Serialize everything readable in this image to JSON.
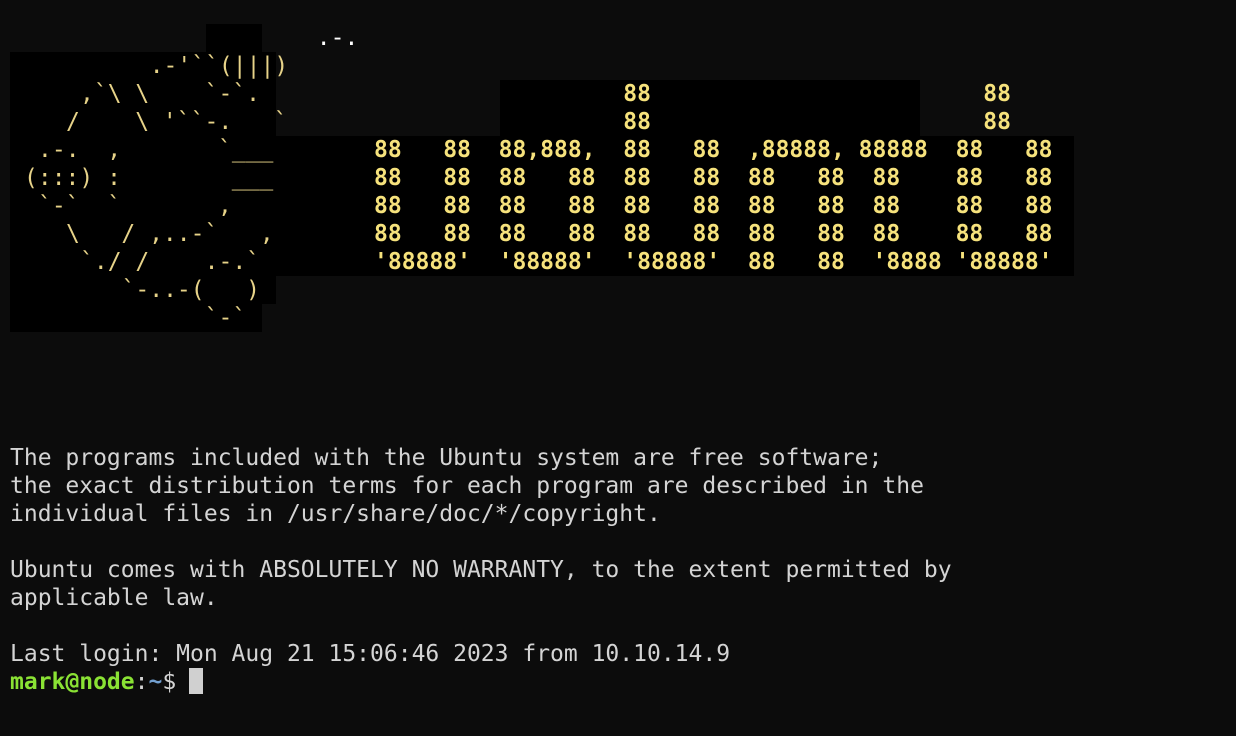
{
  "banner": {
    "logo_rows": [
      "        .-.",
      "  .-'``(|||)",
      ",`\\ \\    `-`.",
      "/    \\ '``-.   `",
      ".-.  ,       `___:",
      "(:::) :        ___",
      "`-`  `       ,   :",
      "\\   / ,..-`   ,",
      "`./ /    .-.`",
      "   `-..-(   )",
      "         `-`"
    ],
    "word_rows": [
      "                  88                        88",
      "                  88                        88",
      "88   88  88,888,  88   88  ,88888, 88888  88   88",
      "88   88  88   88  88   88  88   88  88    88   88",
      "88   88  88   88  88   88  88   88  88    88   88",
      "88   88  88   88  88   88  88   88  88    88   88",
      "'88888'  '88888'  '88888'  88   88  '8888 '88888'"
    ]
  },
  "motd": {
    "line1": "The programs included with the Ubuntu system are free software;",
    "line2": "the exact distribution terms for each program are described in the",
    "line3": "individual files in /usr/share/doc/*/copyright.",
    "line4": "Ubuntu comes with ABSOLUTELY NO WARRANTY, to the extent permitted by",
    "line5": "applicable law."
  },
  "last_login": "Last login: Mon Aug 21 15:06:46 2023 from 10.10.14.9",
  "prompt": {
    "user_host": "mark@node",
    "separator": ":",
    "path": "~",
    "symbol": "$"
  },
  "colors": {
    "background": "#0c0c0c",
    "text": "#d4d4d4",
    "banner_yellow": "#f6e27c",
    "prompt_green": "#8ae234",
    "prompt_blue": "#729fcf"
  }
}
